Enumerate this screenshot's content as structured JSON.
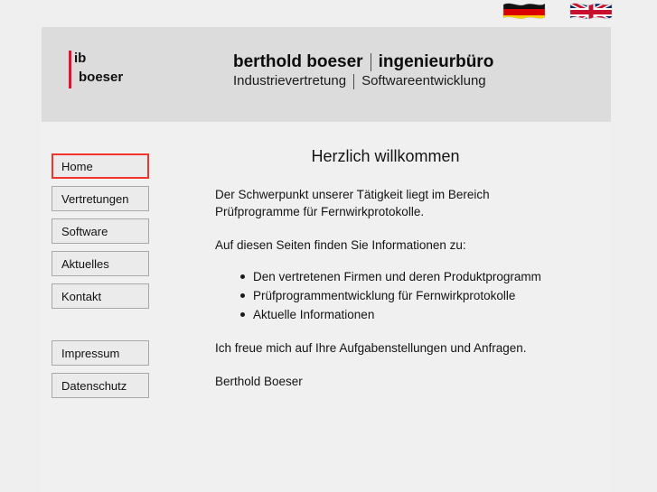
{
  "language_bar": {
    "flags": [
      {
        "name": "german-flag",
        "label": "Deutsch",
        "colors": [
          "#000000",
          "#dd0000",
          "#ffce00"
        ]
      },
      {
        "name": "uk-flag",
        "label": "English",
        "colors": [
          "#012169",
          "#ffffff",
          "#c8102e"
        ]
      }
    ]
  },
  "header": {
    "logo": {
      "line1": "ib",
      "line2": "boeser",
      "rule_color": "#e8112d"
    },
    "title": {
      "main_left": "berthold boeser",
      "main_right": "ingenieurbüro",
      "sub_left": "Industrievertretung",
      "sub_right": "Softwareentwicklung",
      "separator": "|"
    },
    "background_color": "#dcdcdc"
  },
  "sidebar": {
    "items": [
      {
        "label": "Home",
        "active": true
      },
      {
        "label": "Vertretungen",
        "active": false
      },
      {
        "label": "Software",
        "active": false
      },
      {
        "label": "Aktuelles",
        "active": false
      },
      {
        "label": "Kontakt",
        "active": false
      }
    ],
    "secondary_items": [
      {
        "label": "Impressum",
        "active": false
      },
      {
        "label": "Datenschutz",
        "active": false
      }
    ],
    "active_border_color": "#f0352f",
    "button_background": "#ebebeb",
    "button_border": "#a8a8a8"
  },
  "main": {
    "heading": "Herzlich willkommen",
    "paragraph_1": "Der Schwerpunkt unserer Tätigkeit liegt im Bereich Prüfprogramme für Fernwirkprotokolle.",
    "paragraph_2": "Auf diesen Seiten finden Sie Informationen zu:",
    "bullets": [
      "Den vertretenen Firmen und deren Produktprogramm",
      "Prüfprogrammentwicklung für Fernwirkprotokolle",
      "Aktuelle Informationen"
    ],
    "paragraph_3": "Ich freue mich auf Ihre Aufgabenstellungen und Anfragen.",
    "signature": "Berthold Boeser"
  },
  "page": {
    "background_color": "#efefef",
    "content_background_color": "#f0f0f0"
  }
}
